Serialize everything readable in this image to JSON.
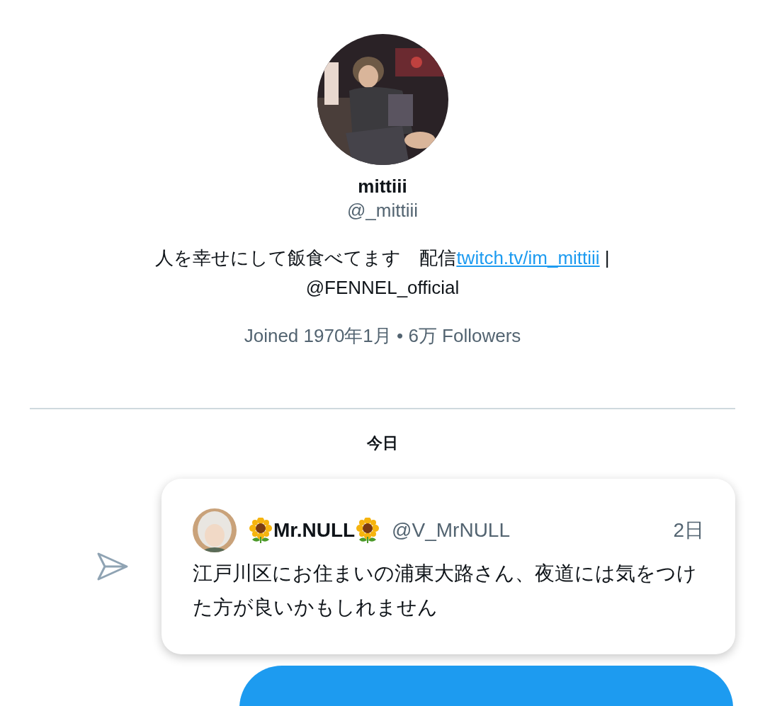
{
  "profile": {
    "name": "mittiii",
    "handle": "@_mittiii",
    "bio": {
      "text": "人を幸せにして飯食べてます　配信",
      "link": "twitch.tv/im_mittiii",
      "after": " |",
      "mention": "@FENNEL_official"
    },
    "meta": "Joined 1970年1月 • 6万 Followers"
  },
  "date_separator": "今日",
  "messages": [
    {
      "kind": "quoted_tweet",
      "author": "Mr.NULL",
      "handle": "@V_MrNULL",
      "time": "2日",
      "text": "江戸川区にお住まいの浦東大路さん、夜道には気をつけた方が良いかもしれません"
    },
    {
      "kind": "bubble"
    }
  ]
}
